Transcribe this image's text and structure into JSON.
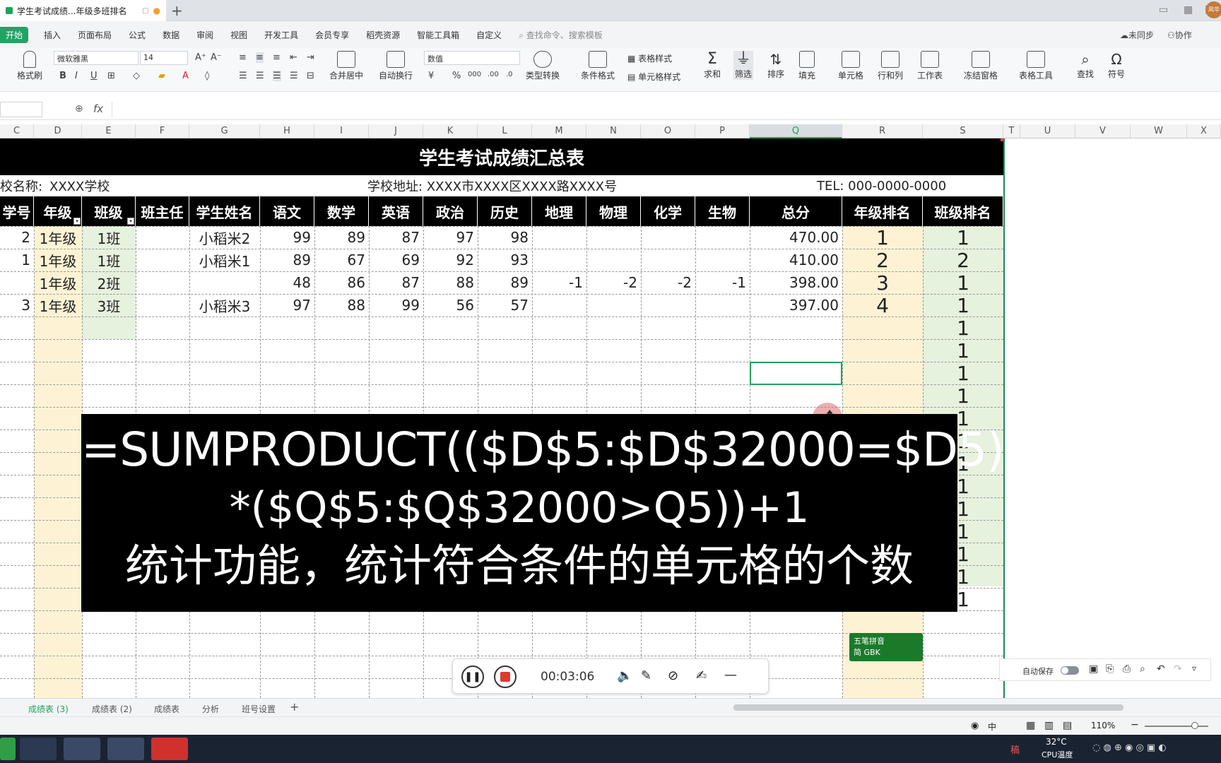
{
  "titlebar": {
    "doc_title": "学生考试成绩...年级多班排名",
    "new_tab": "+",
    "avatar_text": "凤华"
  },
  "menu": {
    "start": "开始",
    "items": [
      "插入",
      "页面布局",
      "公式",
      "数据",
      "审阅",
      "视图",
      "开发工具",
      "会员专享",
      "稻壳资源",
      "智能工具箱",
      "自定义"
    ],
    "search_placeholder": "查找命令、搜索模板",
    "sync": "未同步",
    "collab": "协作"
  },
  "ribbon": {
    "paste_label": "格式刷",
    "font_name": "微软雅黑",
    "font_size": "14",
    "merge": "合并居中",
    "wrap": "自动换行",
    "number_format": "数值",
    "type_convert": "类型转换",
    "cond_format": "条件格式",
    "table_style": "表格样式",
    "cell_style": "单元格样式",
    "sum": "求和",
    "filter": "筛选",
    "sort": "排序",
    "fill": "填充",
    "cell": "单元格",
    "rowcol": "行和列",
    "worksheet": "工作表",
    "freeze": "冻结窗格",
    "table_tools": "表格工具",
    "find": "查找",
    "symbol": "符号"
  },
  "formula_bar": {
    "fx": "fx",
    "value": ""
  },
  "columns": [
    "C",
    "D",
    "E",
    "F",
    "G",
    "H",
    "I",
    "J",
    "K",
    "L",
    "M",
    "N",
    "O",
    "P",
    "Q",
    "R",
    "S",
    "T",
    "U",
    "V",
    "W",
    "X"
  ],
  "sheet": {
    "title": "学生考试成绩汇总表",
    "school_label": "校名称:",
    "school_name": "XXXX学校",
    "address": "学校地址: XXXX市XXXX区XXXX路XXXX号",
    "tel": "TEL: 000-0000-0000",
    "headers": [
      "学号",
      "年级",
      "班级",
      "班主任",
      "学生姓名",
      "语文",
      "数学",
      "英语",
      "政治",
      "历史",
      "地理",
      "物理",
      "化学",
      "生物",
      "总分",
      "年级排名",
      "班级排名"
    ],
    "rows": [
      [
        "2",
        "1年级",
        "1班",
        "",
        "小稻米2",
        "99",
        "89",
        "87",
        "97",
        "98",
        "",
        "",
        "",
        "",
        "470.00",
        "1",
        "1"
      ],
      [
        "1",
        "1年级",
        "1班",
        "",
        "小稻米1",
        "89",
        "67",
        "69",
        "92",
        "93",
        "",
        "",
        "",
        "",
        "410.00",
        "2",
        "2"
      ],
      [
        "",
        "1年级",
        "2班",
        "",
        "",
        "48",
        "86",
        "87",
        "88",
        "89",
        "-1",
        "-2",
        "-2",
        "-1",
        "398.00",
        "3",
        "1"
      ],
      [
        "3",
        "1年级",
        "3班",
        "",
        "小稻米3",
        "97",
        "88",
        "99",
        "56",
        "57",
        "",
        "",
        "",
        "",
        "397.00",
        "4",
        "1"
      ]
    ],
    "extra_class_rank": [
      "1",
      "1",
      "1",
      "1",
      "1",
      "1",
      "1",
      "1",
      "1",
      "1",
      "1",
      "1",
      "1"
    ]
  },
  "overlay": {
    "line1": "=SUMPRODUCT(($D$5:$D$32000=$D5)",
    "line2": "*($Q$5:$Q$32000>Q5))+1",
    "line3": "统计功能，统计符合条件的单元格的个数"
  },
  "ime": {
    "name": "五笔拼音",
    "mode": "简 GBK"
  },
  "recorder": {
    "time": "00:03:06"
  },
  "autosave": {
    "label": "自动保存"
  },
  "sheet_tabs": [
    "成绩表 (3)",
    "成绩表 (2)",
    "成绩表",
    "分析",
    "班号设置"
  ],
  "statusbar": {
    "zoom": "110%",
    "lang": "中"
  },
  "taskbar": {
    "weather": "32°C",
    "cpu": "CPU温度"
  }
}
